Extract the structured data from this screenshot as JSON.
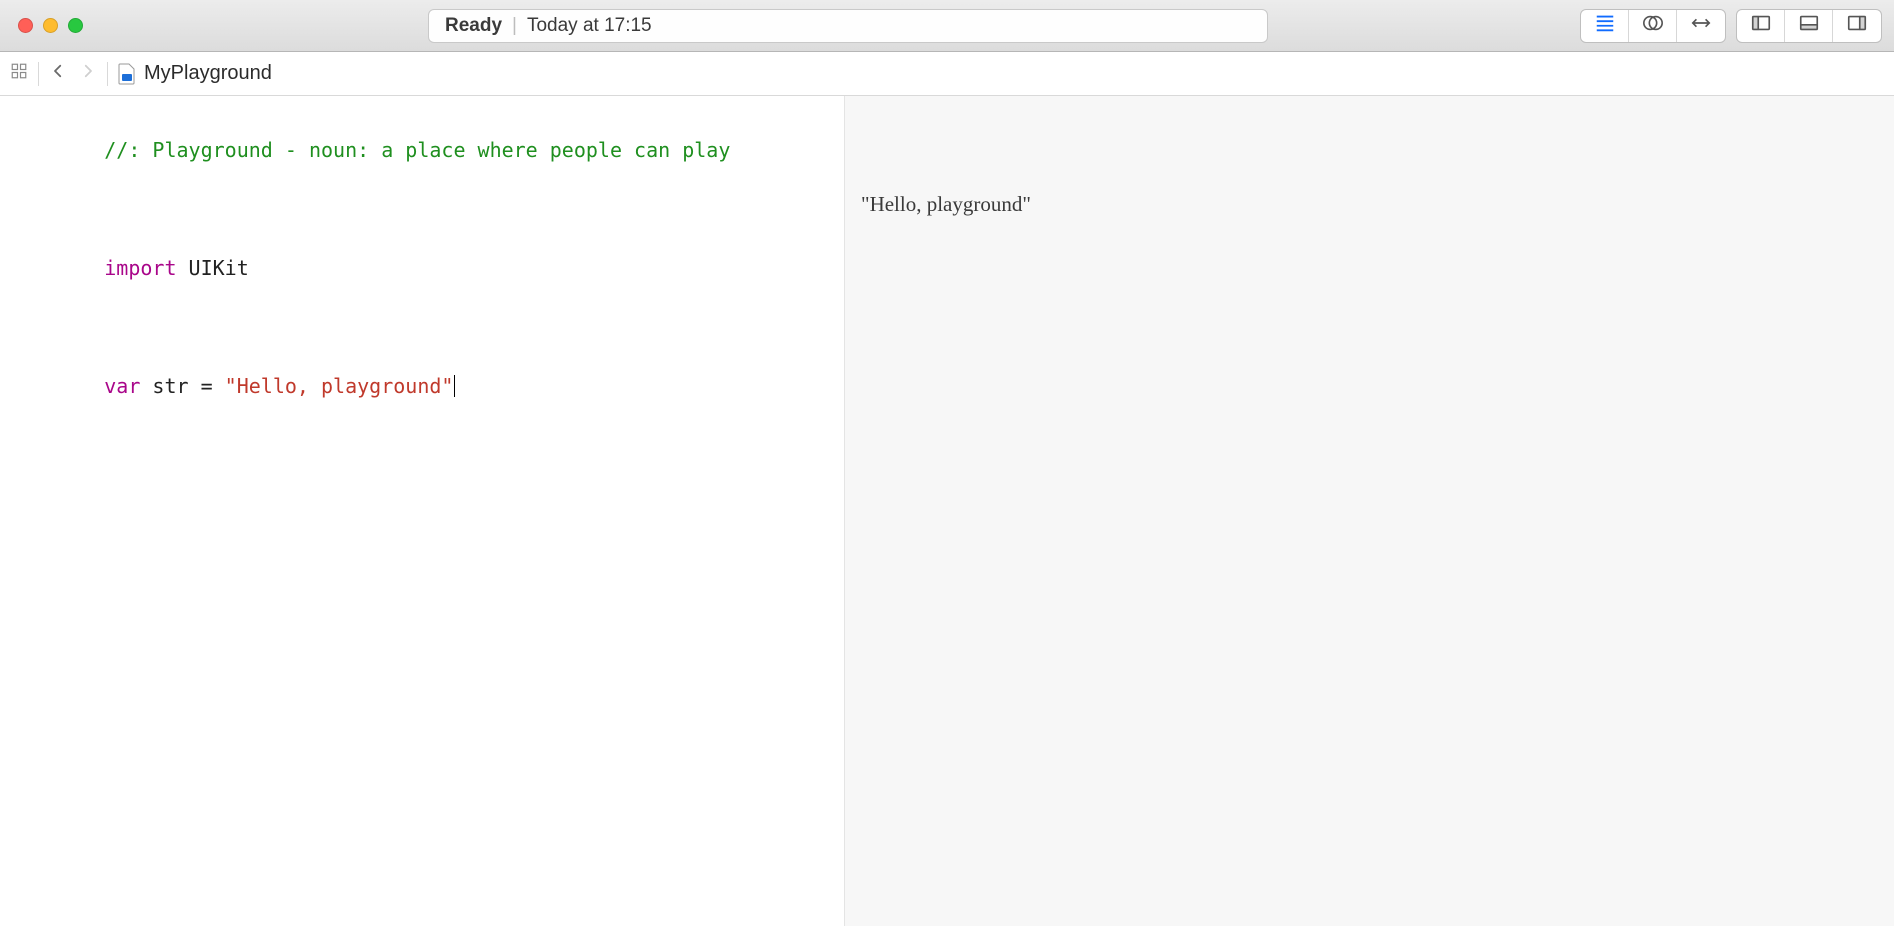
{
  "titlebar": {
    "status_label": "Ready",
    "status_time": "Today at 17:15"
  },
  "toolbar": {
    "editor_mode_icons": [
      "lines-icon",
      "venn-icon",
      "arrows-icon"
    ],
    "panel_icons": [
      "panel-left-icon",
      "panel-bottom-icon",
      "panel-right-icon"
    ]
  },
  "breadcrumb": {
    "file_name": "MyPlayground"
  },
  "code": {
    "comment": "//: Playground - noun: a place where people can play",
    "import_kw": "import",
    "import_mod": "UIKit",
    "var_kw": "var",
    "var_name": "str",
    "equals": " = ",
    "string_literal": "\"Hello, playground\""
  },
  "results": {
    "line1": "\"Hello, playground\""
  }
}
